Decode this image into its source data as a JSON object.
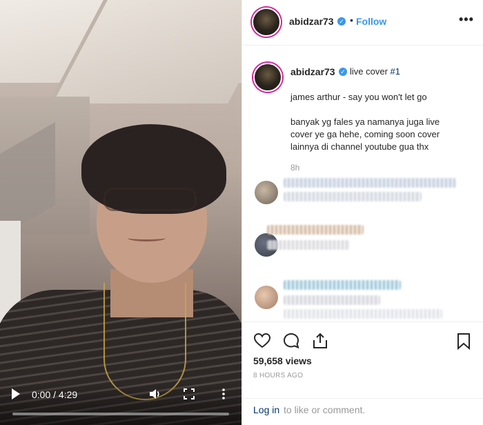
{
  "video": {
    "time": "0:00 / 4:29",
    "progress": 0.0
  },
  "post": {
    "username": "abidzar73",
    "follow_label": "Follow",
    "separator": "•",
    "more_label": "•••",
    "caption": {
      "username": "abidzar73",
      "title_prefix": "live cover ",
      "hashtag": "#1",
      "line1": "james arthur - say you won't let go",
      "line2": "banyak yg fales ya namanya juga live",
      "line3": "cover ye ga hehe, coming soon cover",
      "line4": "lainnya di channel youtube gua thx",
      "age": "8h"
    },
    "views": "59,658 views",
    "posted": "8 HOURS AGO",
    "login_link": "Log in",
    "login_rest": "to like or comment."
  },
  "icons": {
    "play": "play-icon",
    "volume": "volume-icon",
    "fullscreen": "fullscreen-icon",
    "more": "more-vertical-icon",
    "verified": "verified-badge-icon",
    "like": "heart-icon",
    "comment": "comment-icon",
    "share": "share-icon",
    "save": "bookmark-icon"
  },
  "colors": {
    "link": "#3897f0",
    "verified": "#3897f0",
    "story_ring": "#d6249f"
  }
}
